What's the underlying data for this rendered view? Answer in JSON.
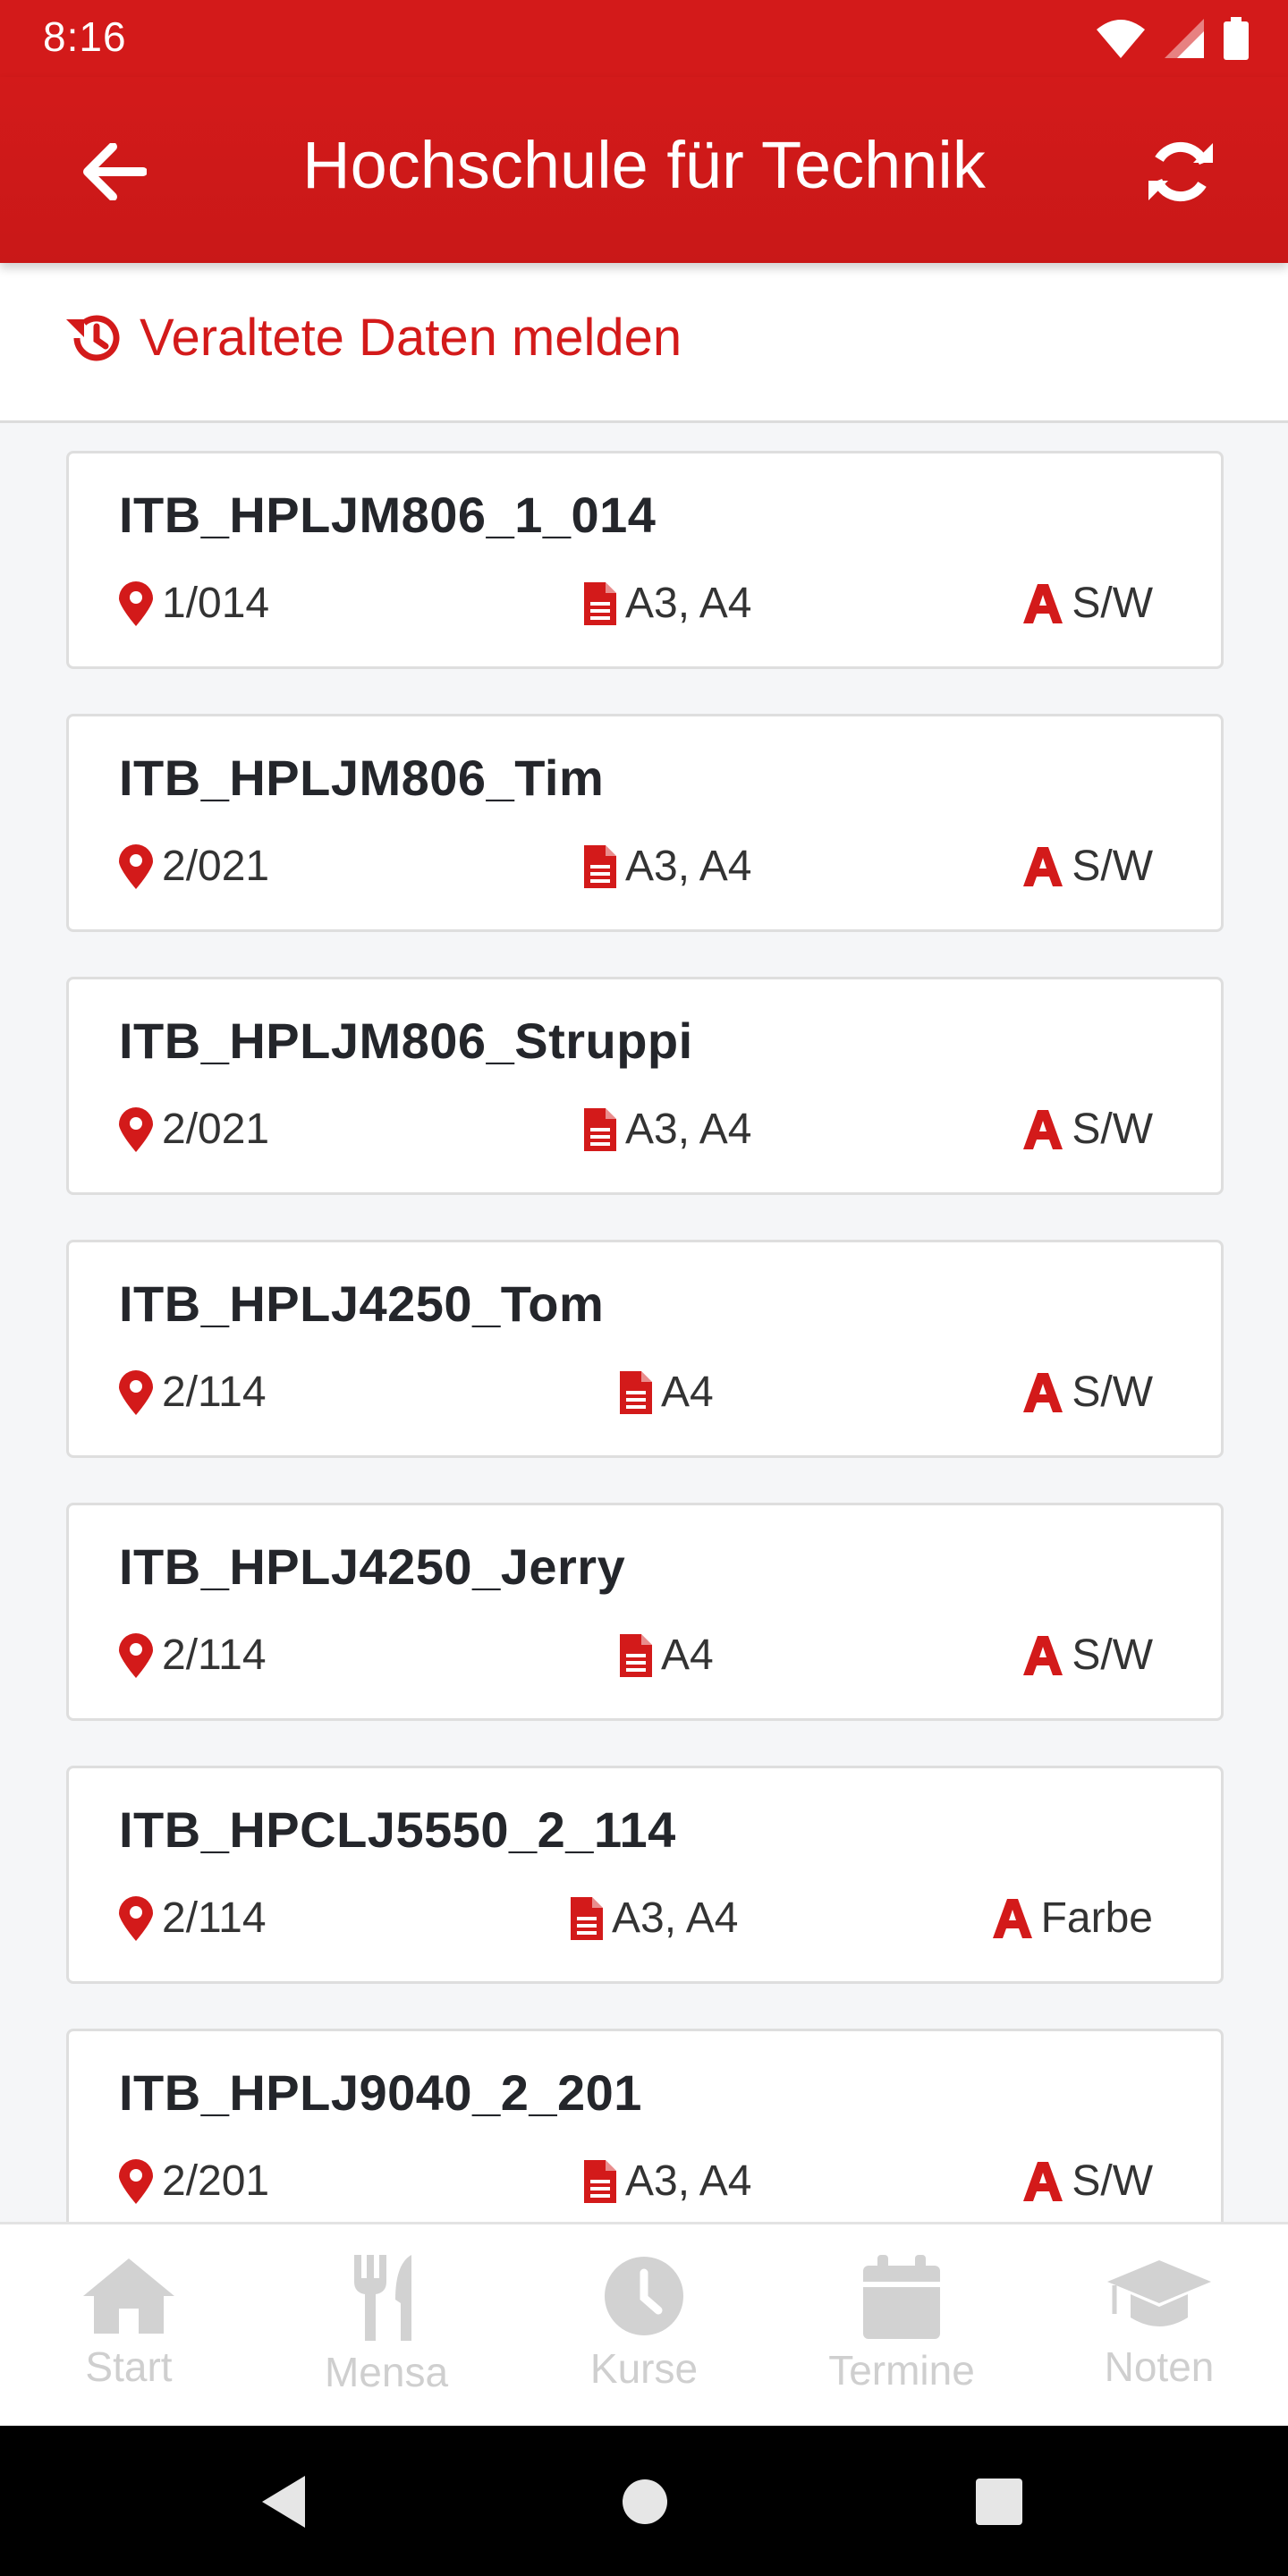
{
  "status_bar": {
    "time": "8:16",
    "icons": [
      "wifi-icon",
      "signal-icon",
      "battery-icon"
    ]
  },
  "app_bar": {
    "title": "Hochschule für Technik",
    "back_icon": "arrow-left-icon",
    "refresh_icon": "refresh-icon"
  },
  "report": {
    "label": "Veraltete Daten melden",
    "icon": "history-icon"
  },
  "colors": {
    "accent": "#d31a1a",
    "nav_inactive": "#cfcfcf"
  },
  "printers": [
    {
      "name": "ITB_HPLJM806_1_014",
      "location": "1/014",
      "formats": "A3, A4",
      "color": "S/W"
    },
    {
      "name": "ITB_HPLJM806_Tim",
      "location": "2/021",
      "formats": "A3, A4",
      "color": "S/W"
    },
    {
      "name": "ITB_HPLJM806_Struppi",
      "location": "2/021",
      "formats": "A3, A4",
      "color": "S/W"
    },
    {
      "name": "ITB_HPLJ4250_Tom",
      "location": "2/114",
      "formats": "A4",
      "color": "S/W"
    },
    {
      "name": "ITB_HPLJ4250_Jerry",
      "location": "2/114",
      "formats": "A4",
      "color": "S/W"
    },
    {
      "name": "ITB_HPCLJ5550_2_114",
      "location": "2/114",
      "formats": "A3, A4",
      "color": "Farbe"
    },
    {
      "name": "ITB_HPLJ9040_2_201",
      "location": "2/201",
      "formats": "A3, A4",
      "color": "S/W"
    }
  ],
  "bottom_nav": [
    {
      "label": "Start",
      "icon": "home-icon"
    },
    {
      "label": "Mensa",
      "icon": "cutlery-icon"
    },
    {
      "label": "Kurse",
      "icon": "clock-icon"
    },
    {
      "label": "Termine",
      "icon": "calendar-icon"
    },
    {
      "label": "Noten",
      "icon": "graduation-cap-icon"
    }
  ],
  "system_nav": [
    "back-triangle-icon",
    "home-circle-icon",
    "recents-square-icon"
  ]
}
